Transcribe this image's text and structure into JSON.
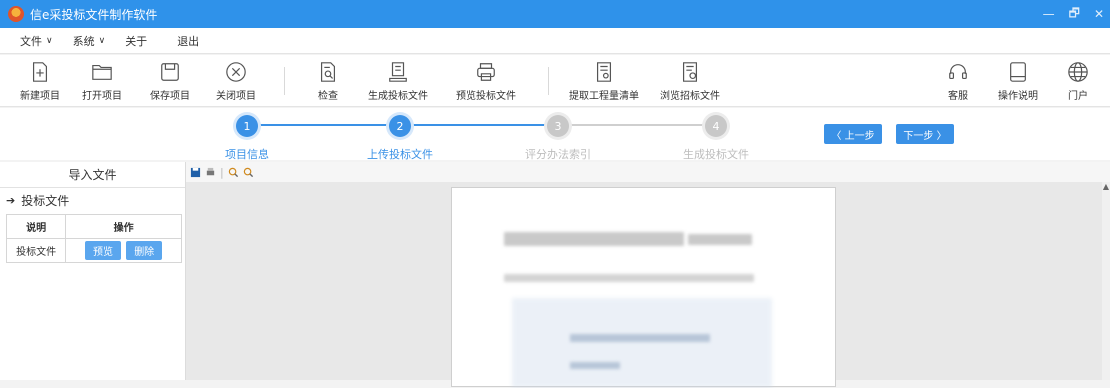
{
  "window": {
    "title": "信e采投标文件制作软件",
    "controls": [
      "—",
      "🗗",
      "✕"
    ]
  },
  "menu": [
    {
      "label": "文件",
      "has_dropdown": true
    },
    {
      "label": "系统",
      "has_dropdown": true
    },
    {
      "label": "关于",
      "has_dropdown": false
    },
    {
      "label": "退出",
      "has_dropdown": false
    }
  ],
  "toolbar": {
    "new_project": "新建项目",
    "open_project": "打开项目",
    "save_project": "保存项目",
    "close_project": "关闭项目",
    "check": "检查",
    "generate_bid": "生成投标文件",
    "preview_bid": "预览投标文件",
    "extract_bill": "提取工程量清单",
    "browse_tender": "浏览招标文件",
    "support": "客服",
    "manual": "操作说明",
    "portal": "门户"
  },
  "steps": [
    {
      "num": "1",
      "label": "项目信息",
      "active": true
    },
    {
      "num": "2",
      "label": "上传投标文件",
      "active": true
    },
    {
      "num": "3",
      "label": "评分办法索引",
      "active": false
    },
    {
      "num": "4",
      "label": "生成投标文件",
      "active": false
    }
  ],
  "nav": {
    "prev": "〈 上一步",
    "next": "下一步 〉"
  },
  "left_panel": {
    "header": "导入文件",
    "section": "投标文件",
    "table": {
      "columns": [
        "说明",
        "操作"
      ],
      "rows": [
        {
          "desc": "投标文件",
          "preview": "预览",
          "delete": "删除"
        }
      ]
    }
  },
  "colors": {
    "accent": "#3a91e6",
    "titlebar": "#2f92ea",
    "inactive_step": "#c8c8c8"
  }
}
